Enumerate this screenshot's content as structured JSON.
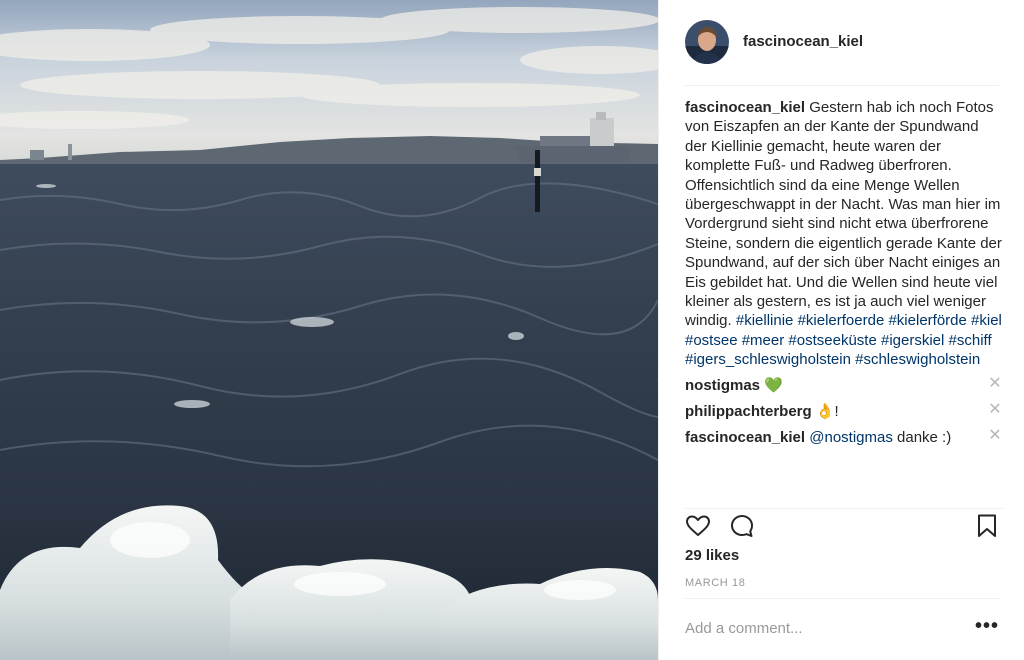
{
  "post": {
    "username": "fascinocean_kiel",
    "caption_text": " Gestern hab ich noch Fotos von Eiszapfen an der Kante der Spundwand der Kiellinie gemacht, heute waren der komplette Fuß- und Radweg überfroren. Offensichtlich sind da eine Menge Wellen übergeschwappt in der Nacht. Was man hier im Vordergrund sieht sind nicht etwa überfrorene Steine, sondern die eigentlich gerade Kante der Spundwand, auf der sich über Nacht einiges an Eis gebildet hat. Und die Wellen sind heute viel kleiner als gestern, es ist ja auch viel weniger windig. ",
    "hashtags": [
      "#kiellinie",
      "#kielerfoerde",
      "#kielerförde",
      "#kiel",
      "#ostsee",
      "#meer",
      "#ostseeküste",
      "#igerskiel",
      "#schiff",
      "#igers_schleswigholstein",
      "#schleswigholstein"
    ],
    "likes": "29 likes",
    "date": "MARCH 18"
  },
  "comments": [
    {
      "username": "nostigmas",
      "text": " 💚"
    },
    {
      "username": "philippachterberg",
      "text": " 👌!"
    },
    {
      "username": "fascinocean_kiel",
      "mention": "@nostigmas",
      "text": " danke :)"
    }
  ],
  "add_comment": {
    "placeholder": "Add a comment..."
  },
  "icons": {
    "like": "heart-icon",
    "comment": "speech-bubble-icon",
    "save": "bookmark-icon",
    "more": "more-options-icon",
    "remove": "close-icon"
  },
  "colors": {
    "text": "#262626",
    "hashtag": "#003569",
    "muted": "#999999",
    "divider": "#efefef"
  }
}
